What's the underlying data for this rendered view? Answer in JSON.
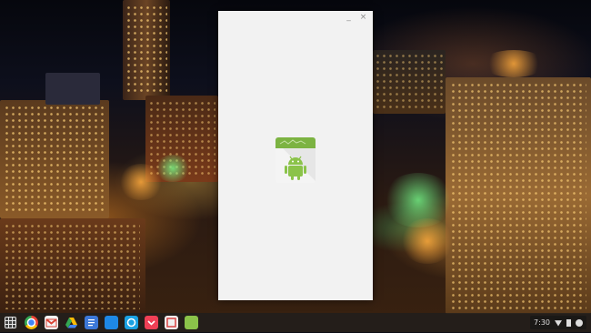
{
  "window": {
    "minimize_glyph": "_",
    "close_glyph": "×",
    "splash_icon": "android-app-icon"
  },
  "shelf": {
    "launcher_icon": "app-launcher-icon",
    "apps": [
      {
        "name": "chrome-icon",
        "color": "#e94235"
      },
      {
        "name": "gmail-icon",
        "color": "#f4f4f4"
      },
      {
        "name": "google-drive-icon",
        "color": "#2a9d51"
      },
      {
        "name": "google-docs-icon",
        "color": "#3c78d8"
      },
      {
        "name": "app-31-icon",
        "color": "#1e88e5"
      },
      {
        "name": "sync-app-icon",
        "color": "#f0f0f0"
      },
      {
        "name": "pocket-icon",
        "color": "#ef4056"
      },
      {
        "name": "app-icon",
        "color": "#d84343"
      },
      {
        "name": "android-app-icon",
        "color": "#8bc34a"
      }
    ],
    "time": "7:30"
  },
  "colors": {
    "window_bg": "#f2f2f2",
    "android_green": "#8bc34a"
  }
}
